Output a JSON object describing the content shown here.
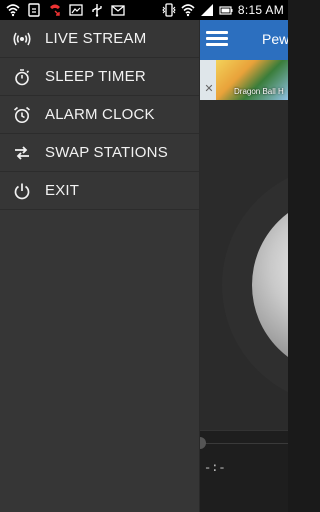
{
  "status_bar": {
    "time": "8:15",
    "time_suffix": "AM",
    "icons_left": [
      "wifi-icon",
      "sim-icon",
      "missed-call-icon",
      "picture-icon",
      "usb-icon",
      "mail-icon"
    ],
    "icons_right": [
      "vibrate-icon",
      "wifi-signal-icon",
      "signal-icon",
      "battery-icon"
    ]
  },
  "app": {
    "title": "Pew",
    "ad_text": "Dragon Ball H",
    "time_readout": "-:-"
  },
  "drawer": {
    "items": [
      {
        "label": "LIVE STREAM",
        "icon": "broadcast-icon"
      },
      {
        "label": "SLEEP TIMER",
        "icon": "stopwatch-icon"
      },
      {
        "label": "ALARM CLOCK",
        "icon": "alarm-clock-icon"
      },
      {
        "label": "SWAP STATIONS",
        "icon": "swap-icon"
      },
      {
        "label": "EXIT",
        "icon": "power-icon"
      }
    ]
  },
  "colors": {
    "drawer_bg": "#363636",
    "header_blue": "#2c6fbf",
    "text": "#f2f2f2"
  }
}
